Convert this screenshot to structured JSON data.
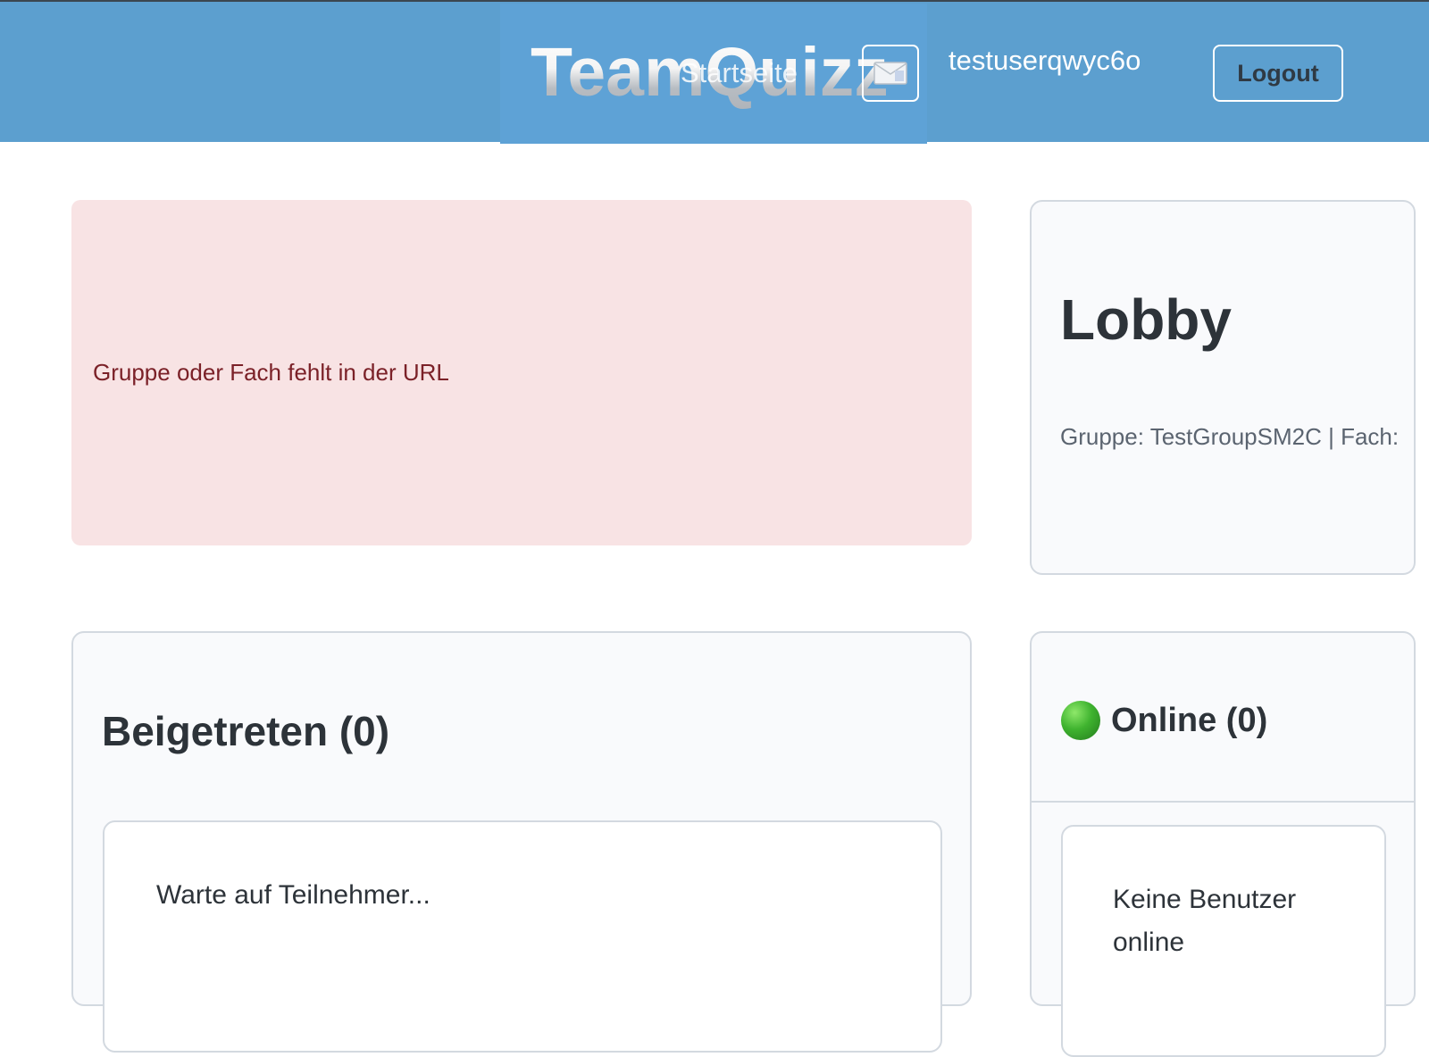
{
  "navbar": {
    "brand": "TeamQuizz",
    "home_link": "Startseite",
    "mail_icon": "envelope-icon",
    "username": "testuserqwyc6o",
    "logout_label": "Logout",
    "color": "#5c9fcf"
  },
  "alert": {
    "message": "Gruppe oder Fach fehlt in der URL",
    "background": "#f8e3e4",
    "text_color": "#7b2128"
  },
  "lobby": {
    "title": "Lobby",
    "meta": "Gruppe: TestGroupSM2C | Fach:"
  },
  "joined": {
    "title": "Beigetreten (0)",
    "empty_text": "Warte auf Teilnehmer..."
  },
  "online": {
    "status_icon": "green-circle-icon",
    "title": "Online (0)",
    "empty_text": "Keine Benutzer online"
  }
}
